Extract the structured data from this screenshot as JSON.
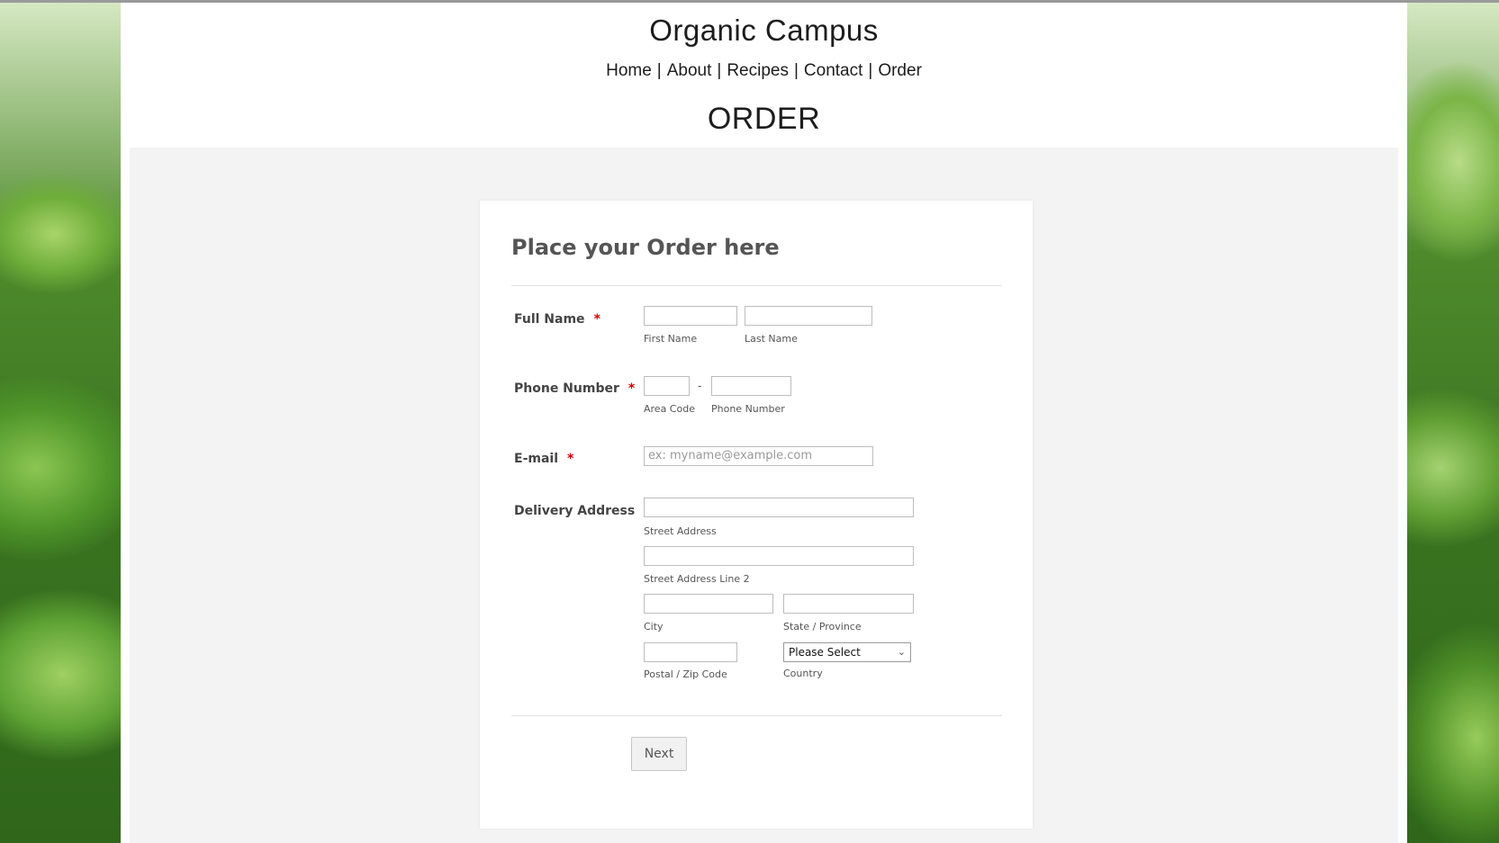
{
  "site": {
    "title": "Organic Campus",
    "nav": [
      "Home",
      "About",
      "Recipes",
      "Contact",
      "Order"
    ],
    "nav_separator": "|",
    "page_heading": "ORDER"
  },
  "form": {
    "title": "Place your Order here",
    "required_mark": "*",
    "full_name": {
      "label": "Full Name",
      "first_sub": "First Name",
      "last_sub": "Last Name",
      "first_value": "",
      "last_value": ""
    },
    "phone": {
      "label": "Phone Number",
      "area_sub": "Area Code",
      "number_sub": "Phone Number",
      "dash": "-"
    },
    "email": {
      "label": "E-mail",
      "placeholder": "ex: myname@example.com"
    },
    "address": {
      "label": "Delivery Address",
      "street_sub": "Street Address",
      "street2_sub": "Street Address Line 2",
      "city_sub": "City",
      "state_sub": "State / Province",
      "postal_sub": "Postal / Zip Code",
      "country_sub": "Country",
      "country_selected": "Please Select"
    },
    "next_label": "Next"
  },
  "colors": {
    "required": "#cc0000",
    "form_background": "#f3f3f3",
    "text": "#444444"
  },
  "icons": {
    "select_arrow": "chevron-down-icon"
  }
}
